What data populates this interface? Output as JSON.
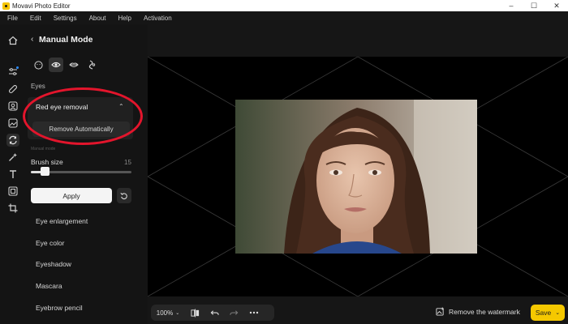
{
  "window": {
    "title": "Movavi Photo Editor",
    "minimize": "–",
    "maximize": "☐",
    "close": "✕"
  },
  "menu": [
    "File",
    "Edit",
    "Settings",
    "About",
    "Help",
    "Activation"
  ],
  "panel": {
    "mode_title": "Manual Mode",
    "section": "Eyes",
    "red_eye": {
      "label": "Red eye removal",
      "button": "Remove Automatically"
    },
    "manual_label": "Manual mode",
    "brush": {
      "label": "Brush size",
      "value": "15",
      "fraction": 0.14
    },
    "apply": "Apply",
    "tools": [
      "Eye enlargement",
      "Eye color",
      "Eyeshadow",
      "Mascara",
      "Eyebrow pencil"
    ]
  },
  "bottom": {
    "zoom": "100%",
    "watermark": "Remove the watermark",
    "save": "Save"
  },
  "colors": {
    "accent": "#f5c800",
    "highlight": "#e3152c"
  }
}
